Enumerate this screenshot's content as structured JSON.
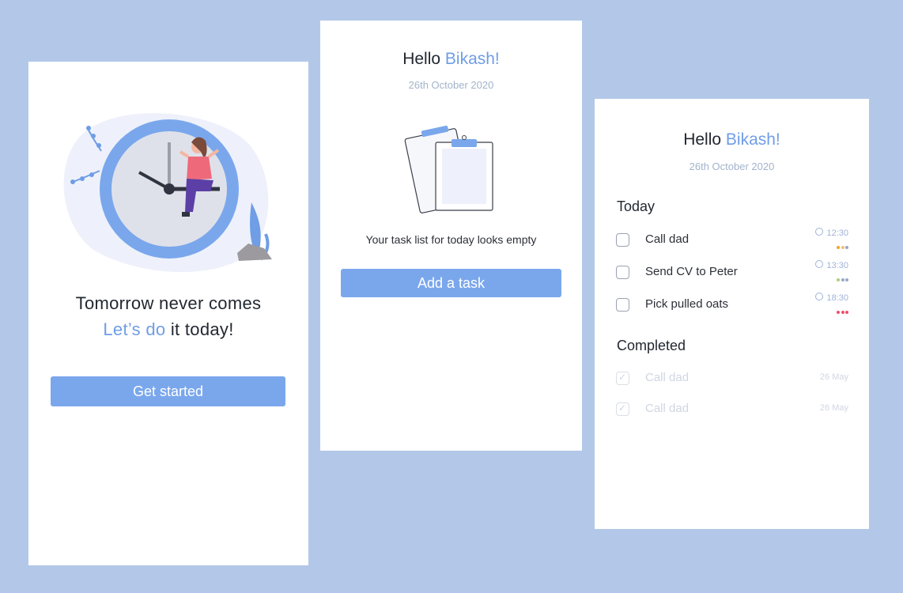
{
  "screen1": {
    "line1": "Tomorrow never comes",
    "line2_accent": "Let’s do",
    "line2_rest": " it today!",
    "button": "Get started"
  },
  "screen2": {
    "greeting": "Hello ",
    "name": "Bikash!",
    "date": "26th October 2020",
    "empty_message": "Your task list for today looks empty",
    "button": "Add a task"
  },
  "screen3": {
    "greeting": "Hello ",
    "name": "Bikash!",
    "date": "26th October 2020",
    "today_heading": "Today",
    "completed_heading": "Completed",
    "today_tasks": [
      {
        "label": "Call dad",
        "time": "12:30",
        "dots": [
          "#f5a623",
          "#e8c27a",
          "#9aa6c9"
        ]
      },
      {
        "label": "Send CV to Peter",
        "time": "13:30",
        "dots": [
          "#a8d07a",
          "#9aa6c9",
          "#9aa6c9"
        ]
      },
      {
        "label": "Pick pulled oats",
        "time": "18:30",
        "dots": [
          "#f0506e",
          "#f0506e",
          "#f0506e"
        ]
      }
    ],
    "completed_tasks": [
      {
        "label": "Call dad",
        "date": "26 May"
      },
      {
        "label": "Call dad",
        "date": "26 May"
      }
    ]
  },
  "colors": {
    "background": "#b3c8e8",
    "accent": "#6f9de6",
    "button": "#7aa7ec"
  }
}
